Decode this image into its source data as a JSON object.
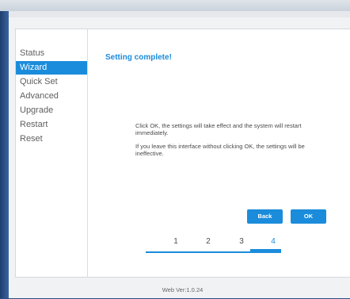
{
  "sidebar": {
    "items": [
      {
        "label": "Status"
      },
      {
        "label": "Wizard"
      },
      {
        "label": "Quick Set"
      },
      {
        "label": "Advanced"
      },
      {
        "label": "Upgrade"
      },
      {
        "label": "Restart"
      },
      {
        "label": "Reset"
      }
    ],
    "active": "Wizard"
  },
  "main": {
    "title": "Setting complete!",
    "message_1": "Click OK, the settings will take effect and the system will restart immediately.",
    "message_2": "If you leave this interface without clicking OK, the settings will be ineffective.",
    "back_label": "Back",
    "ok_label": "OK",
    "steps": [
      "1",
      "2",
      "3",
      "4"
    ],
    "current_step": "4"
  },
  "footer": {
    "version": "Web Ver:1.0.24"
  },
  "colors": {
    "accent": "#1b8cdb",
    "frame": "#2b4f86"
  }
}
